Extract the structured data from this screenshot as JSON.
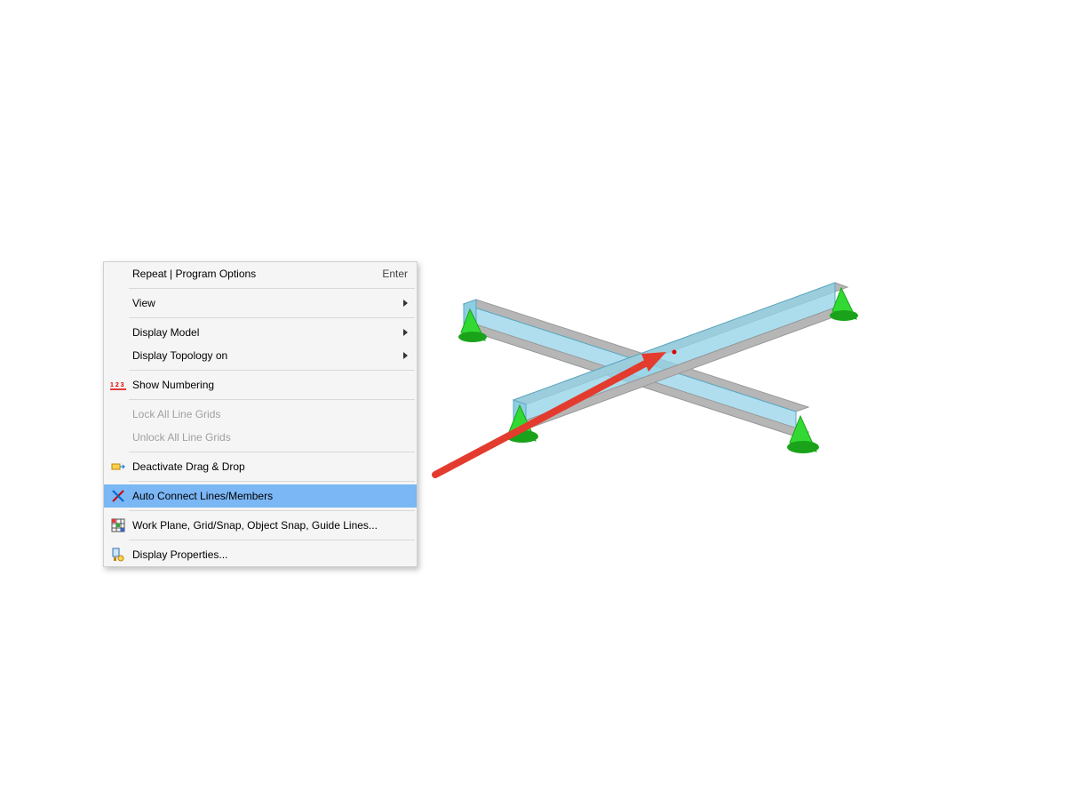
{
  "menu": {
    "items": [
      {
        "label": "Repeat | Program Options",
        "shortcut": "Enter",
        "submenu": false,
        "enabled": true,
        "icon": ""
      },
      {
        "sep": true
      },
      {
        "label": "View",
        "shortcut": "",
        "submenu": true,
        "enabled": true,
        "icon": ""
      },
      {
        "sep": true
      },
      {
        "label": "Display Model",
        "shortcut": "",
        "submenu": true,
        "enabled": true,
        "icon": ""
      },
      {
        "label": "Display Topology on",
        "shortcut": "",
        "submenu": true,
        "enabled": true,
        "icon": ""
      },
      {
        "sep": true
      },
      {
        "label": "Show Numbering",
        "shortcut": "",
        "submenu": false,
        "enabled": true,
        "icon": "numbering"
      },
      {
        "sep": true
      },
      {
        "label": "Lock All Line Grids",
        "shortcut": "",
        "submenu": false,
        "enabled": false,
        "icon": ""
      },
      {
        "label": "Unlock All Line Grids",
        "shortcut": "",
        "submenu": false,
        "enabled": false,
        "icon": ""
      },
      {
        "sep": true
      },
      {
        "label": "Deactivate Drag & Drop",
        "shortcut": "",
        "submenu": false,
        "enabled": true,
        "icon": "drag"
      },
      {
        "sep": true
      },
      {
        "label": "Auto Connect Lines/Members",
        "shortcut": "",
        "submenu": false,
        "enabled": true,
        "icon": "connect",
        "highlight": true
      },
      {
        "sep": true
      },
      {
        "label": "Work Plane, Grid/Snap, Object Snap, Guide Lines...",
        "shortcut": "",
        "submenu": false,
        "enabled": true,
        "icon": "grid"
      },
      {
        "sep": true
      },
      {
        "label": "Display Properties...",
        "shortcut": "",
        "submenu": false,
        "enabled": true,
        "icon": "props"
      }
    ]
  },
  "colors": {
    "beam_fill": "#95d3e8",
    "beam_stroke": "#5aa9c2",
    "flange": "#b6b6b6",
    "support": "#33d933",
    "support_dark": "#1aa31a",
    "arrow": "#e33b2e",
    "highlight": "#7bb6f5",
    "node": "#d00"
  }
}
